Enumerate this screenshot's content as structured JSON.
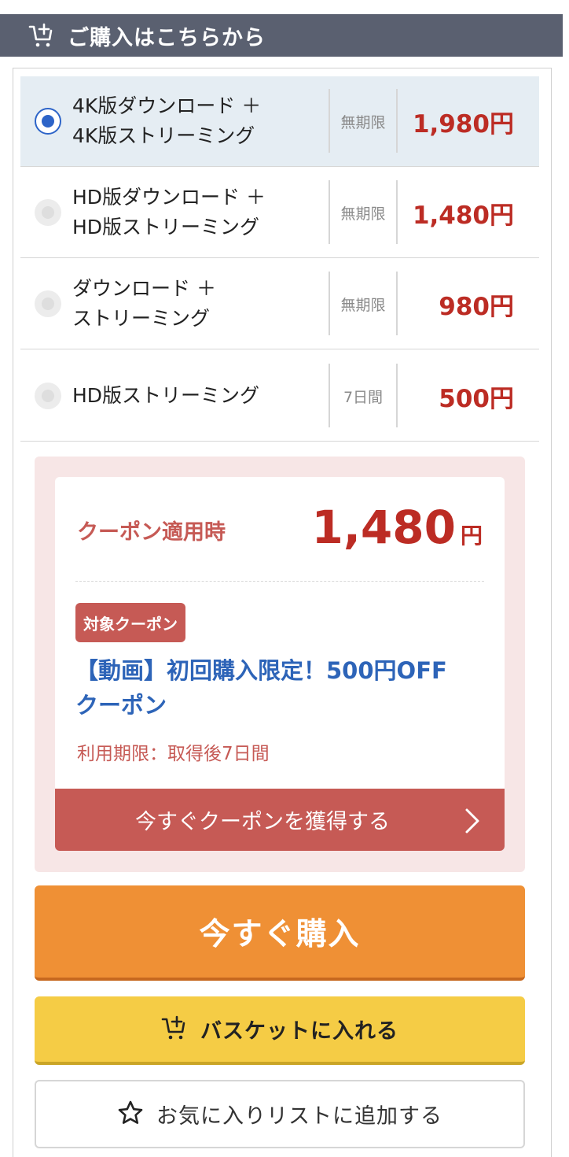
{
  "header": {
    "title": "ご購入はこちらから",
    "icon": "cart-add-icon"
  },
  "options": [
    {
      "label": "4K版ダウンロード ＋\n4K版ストリーミング",
      "period": "無期限",
      "price": "1,980円",
      "selected": true
    },
    {
      "label": "HD版ダウンロード ＋\nHD版ストリーミング",
      "period": "無期限",
      "price": "1,480円",
      "selected": false
    },
    {
      "label": "ダウンロード ＋\nストリーミング",
      "period": "無期限",
      "price": "980円",
      "selected": false
    },
    {
      "label": "HD版ストリーミング",
      "period": "7日間",
      "price": "500円",
      "selected": false
    }
  ],
  "coupon": {
    "applied_label": "クーポン適用時",
    "price_number": "1,480",
    "price_unit": "円",
    "badge": "対象クーポン",
    "name": "【動画】初回購入限定！500円OFF\nクーポン",
    "expiry": "利用期限：取得後7日間",
    "get_button": "今すぐクーポンを獲得する"
  },
  "actions": {
    "buy_now": "今すぐ購入",
    "add_basket": "バスケットに入れる",
    "add_favorite": "お気に入りリストに追加する"
  },
  "colors": {
    "header_bg": "#5a6070",
    "price_red": "#bc2c24",
    "coupon_red": "#c65a55",
    "coupon_link_blue": "#2d64b8",
    "buy_orange": "#ef9035",
    "basket_yellow": "#f5cc45",
    "radio_blue": "#2d64c8"
  }
}
